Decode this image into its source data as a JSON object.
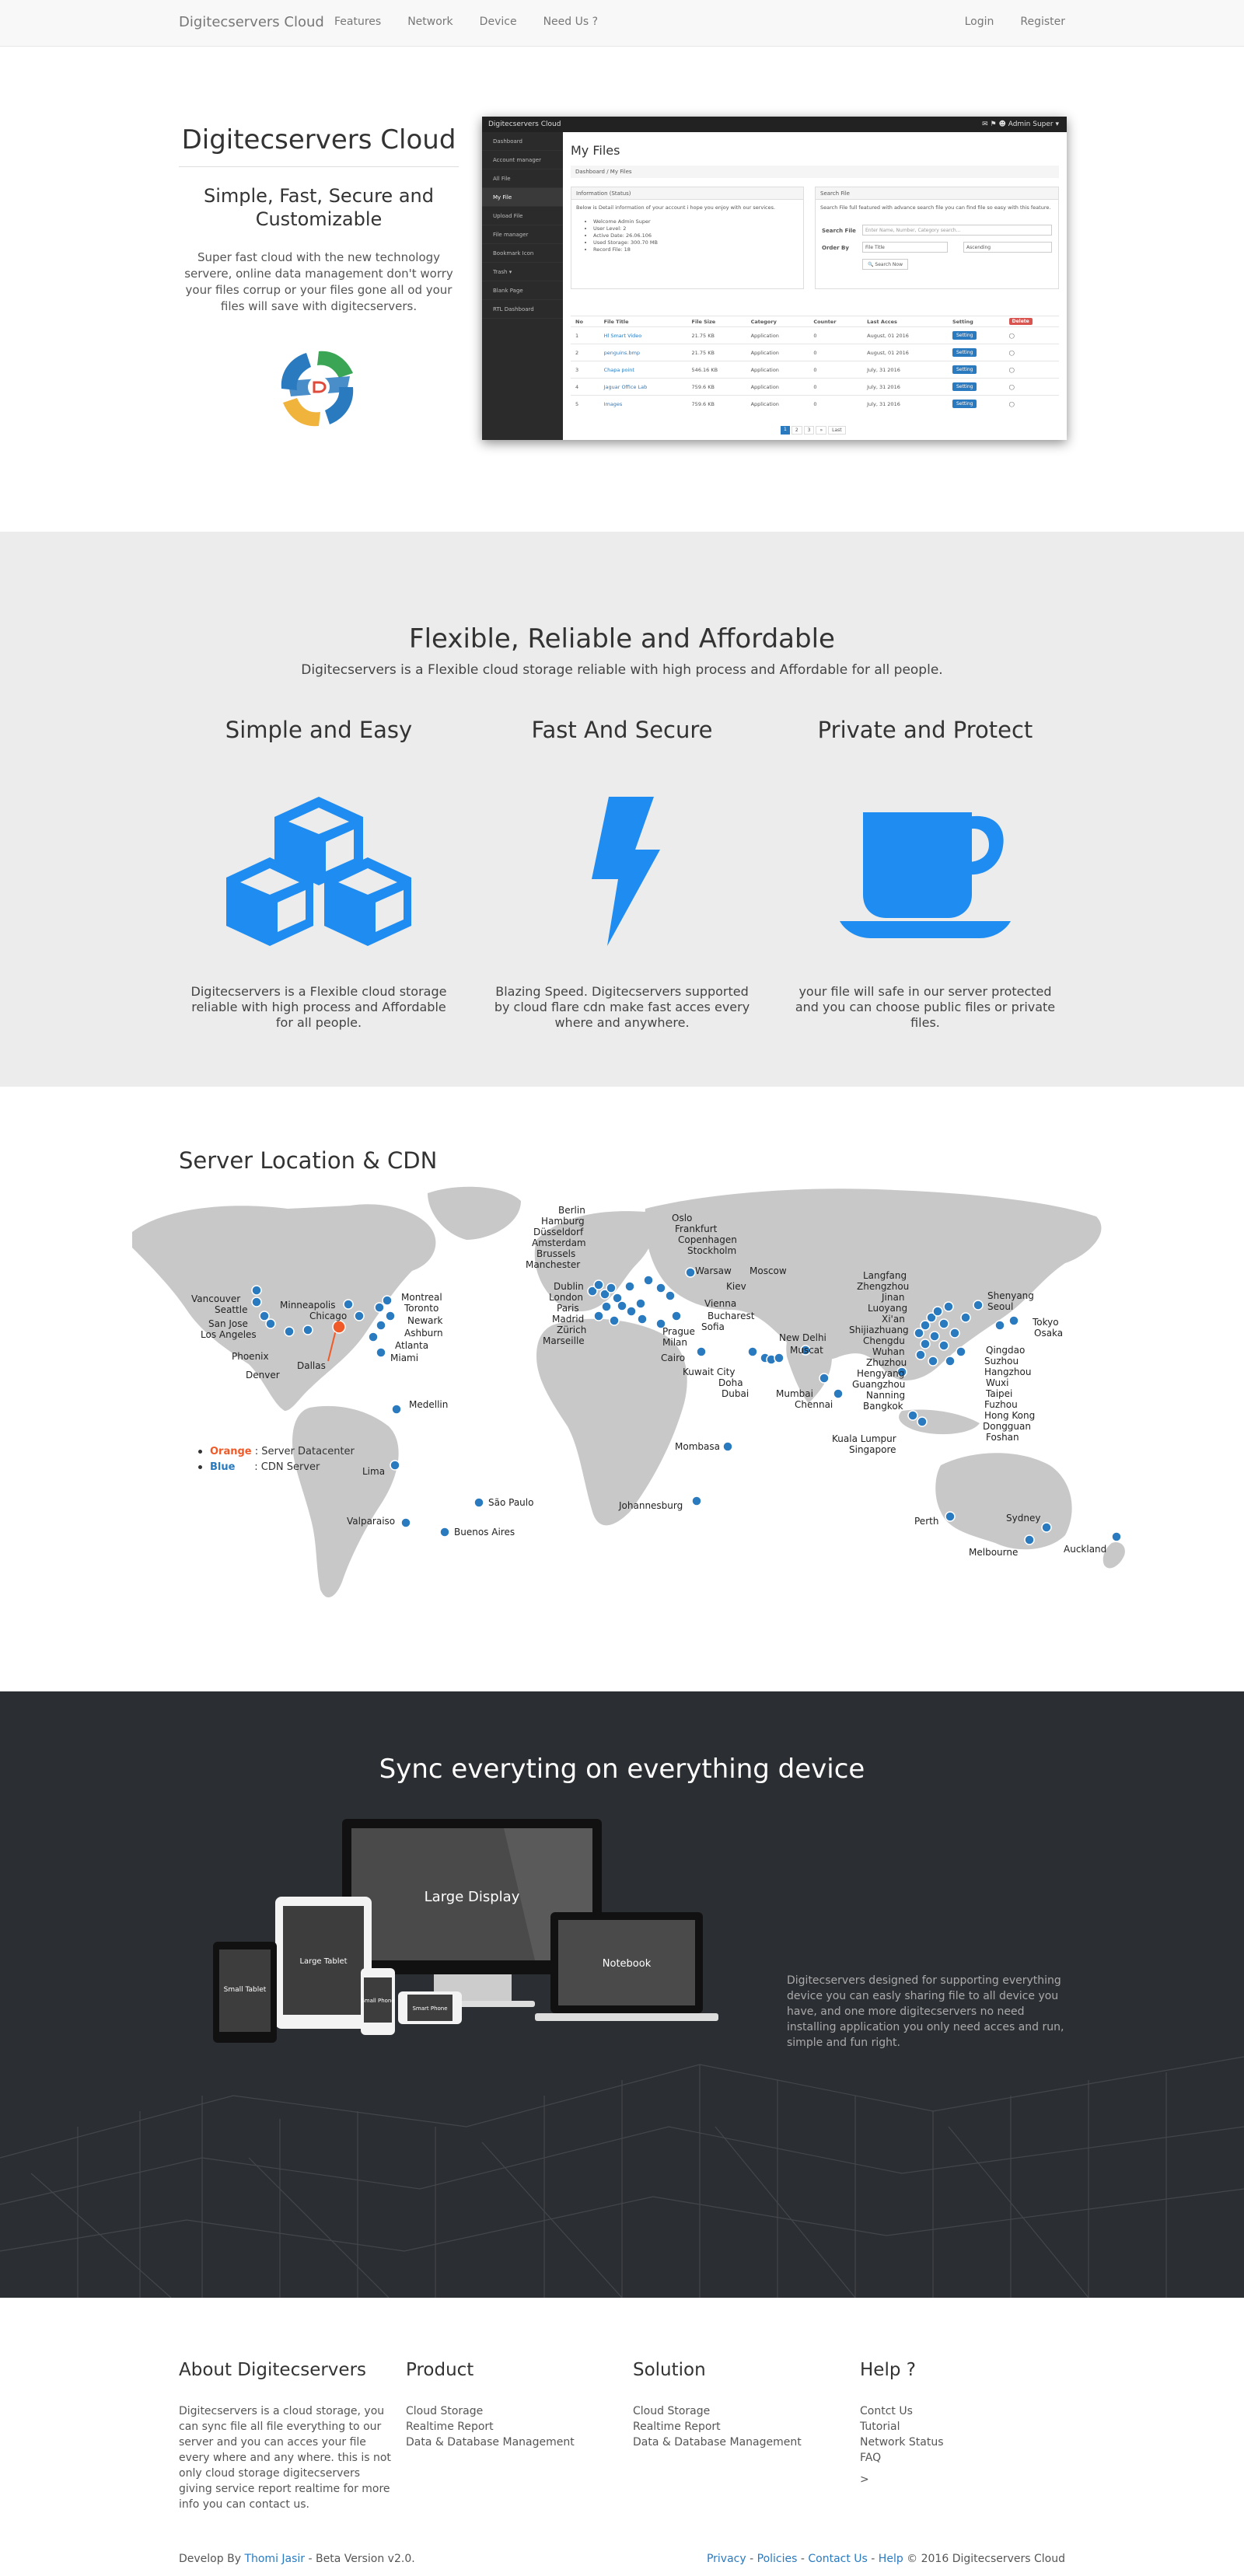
{
  "nav": {
    "brand": "Digitecservers Cloud",
    "links": [
      "Features",
      "Network",
      "Device",
      "Need Us ?"
    ],
    "login": "Login",
    "register": "Register"
  },
  "hero": {
    "title": "Digitecservers Cloud",
    "subtitle": "Simple, Fast, Secure and Customizable",
    "description": "Super fast cloud with the new technology servere, online data management don't worry your files corrup or your files gone all od your files will save with digitecservers."
  },
  "app_mock": {
    "topbar_title": "Digitecservers Cloud",
    "topbar_user": "Admin Super ▾",
    "sidebar": [
      "Dashboard",
      "Account manager",
      "All File",
      "My File",
      "Upload File",
      "File manager",
      "Bookmark Icon",
      "Trash ▾",
      "Blank Page",
      "RTL Dashboard"
    ],
    "active_index": 3,
    "heading": "My Files",
    "breadcrumb": "Dashboard  /  My Files",
    "info_panel_title": "Information (Status)",
    "info_panel_text": "Below is Detail information of your account i hope you enjoy with our services.",
    "info_items": [
      "Welcome Admin Super",
      "User Level: 2",
      "Active Date: 26.06.106",
      "Used Storage: 300.70 MB",
      "Record File: 18"
    ],
    "search_panel_title": "Search File",
    "search_panel_text": "Search File full featured with advance search file you can find file so easy with this feature.",
    "search_label": "Search File",
    "search_placeholder": "Enter Name, Number, Category search...",
    "order_label": "Order By",
    "order_value": "File Title",
    "sort_value": "Ascending",
    "search_button": "Search Now",
    "columns": [
      "No",
      "File Title",
      "File Size",
      "Category",
      "Counter",
      "Last Acces",
      "Setting"
    ],
    "delete_label": "Delete",
    "setting_label": "Setting",
    "rows": [
      {
        "no": "1",
        "title": "Hl Smart Video",
        "size": "21.75 KB",
        "category": "Application",
        "counter": "0",
        "last": "August, 01 2016"
      },
      {
        "no": "2",
        "title": "penguins.bmp",
        "size": "21.75 KB",
        "category": "Application",
        "counter": "0",
        "last": "August, 01 2016"
      },
      {
        "no": "3",
        "title": "Chapa point",
        "size": "546.16 KB",
        "category": "Application",
        "counter": "0",
        "last": "July, 31 2016"
      },
      {
        "no": "4",
        "title": "Jaguar Office Lab",
        "size": "759.6 KB",
        "category": "Application",
        "counter": "0",
        "last": "July, 31 2016"
      },
      {
        "no": "5",
        "title": "Images",
        "size": "759.6 KB",
        "category": "Application",
        "counter": "0",
        "last": "July, 31 2016"
      }
    ],
    "pagination": [
      "1",
      "2",
      "3",
      "»",
      "Last"
    ]
  },
  "features": {
    "title": "Flexible, Reliable and Affordable",
    "subtitle": "Digitecservers is a Flexible cloud storage reliable with high process and Affordable for all people.",
    "items": [
      {
        "title": "Simple and Easy",
        "icon": "cubes-icon",
        "text": "Digitecservers is a Flexible cloud storage reliable with high process and Affordable for all people."
      },
      {
        "title": "Fast And Secure",
        "icon": "lightning-icon",
        "text": "Blazing Speed. Digitecservers supported by cloud flare cdn make fast acces every where and anywhere."
      },
      {
        "title": "Private and Protect",
        "icon": "coffee-cup-icon",
        "text": "your file will safe in our server protected and you can choose public files or private files."
      }
    ],
    "accent_color": "#1e8cf0"
  },
  "map": {
    "title": "Server Location & CDN",
    "legend": [
      {
        "color_word": "Orange",
        "label": " : Server Datacenter",
        "color": "#f05a28"
      },
      {
        "color_word": "Blue",
        "label": "      : CDN Server",
        "color": "#2a7ac0"
      }
    ],
    "datacenter": "Dallas",
    "cities": {
      "europe_labels": [
        "Berlin",
        "Hamburg",
        "Düsseldorf",
        "Amsterdam",
        "Brussels",
        "Manchester",
        "Dublin",
        "London",
        "Paris",
        "Madrid",
        "Zürich",
        "Marseille",
        "Oslo",
        "Frankfurt",
        "Copenhagen",
        "Stockholm",
        "Warsaw",
        "Moscow",
        "Kiev",
        "Vienna",
        "Bucharest",
        "Sofia",
        "Prague",
        "Milan"
      ],
      "america_labels": [
        "Vancouver",
        "Seattle",
        "San Jose",
        "Los Angeles",
        "Phoenix",
        "Denver",
        "Minneapolis",
        "Chicago",
        "Montreal",
        "Toronto",
        "Newark",
        "Ashburn",
        "Atlanta",
        "Miami",
        "Medellin",
        "Lima",
        "Valparaiso",
        "São Paulo",
        "Buenos Aires"
      ],
      "asia_labels": [
        "Langfang",
        "Zhengzhou",
        "Jinan",
        "Luoyang",
        "Xi'an",
        "Shijiazhuang",
        "Chengdu",
        "Wuhan",
        "Zhuzhou",
        "Hengyang",
        "Guangzhou",
        "Nanning",
        "Bangkok",
        "Shenyang",
        "Seoul",
        "Tokyo",
        "Osaka",
        "Qingdao",
        "Suzhou",
        "Hangzhou",
        "Wuxi",
        "Taipei",
        "Fuzhou",
        "Hong Kong",
        "Dongguan",
        "Foshan",
        "New Delhi",
        "Muscat",
        "Kuwait City",
        "Doha",
        "Dubai",
        "Mumbai",
        "Chennai",
        "Kuala Lumpur",
        "Singapore",
        "Cairo",
        "Mombasa",
        "Johannesburg",
        "Perth",
        "Sydney",
        "Melbourne",
        "Auckland"
      ]
    }
  },
  "sync": {
    "title": "Sync everyting on everything device",
    "devices": [
      "Large Display",
      "Notebook",
      "Large Tablet",
      "Small Tablet",
      "Small Phone",
      "Smart Phone"
    ],
    "description": "Digitecservers designed for supporting everything device you can easly sharing file to all device you have, and one more digitecservers no need installing application you only need acces and run, simple and fun right."
  },
  "footer": {
    "about_title": "About Digitecservers",
    "about_text": "Digitecservers is a cloud storage, you can sync file all file everything to our server and you can acces your file every where and any where. this is not only cloud storage digitecservers giving service report realtime for more info you can contact us.",
    "product_title": "Product",
    "product_items": [
      "Cloud Storage",
      "Realtime Report",
      "Data & Database Management"
    ],
    "solution_title": "Solution",
    "solution_items": [
      "Cloud Storage",
      "Realtime Report",
      "Data & Database Management"
    ],
    "help_title": "Help ?",
    "help_items": [
      "Contct Us",
      "Tutorial",
      "Network Status",
      "FAQ",
      ">"
    ],
    "dev_prefix": "Develop By ",
    "dev_name": "Thomi Jasir",
    "dev_suffix": " - Beta Version v2.0.",
    "links": [
      "Privacy",
      "Policies",
      "Contact Us",
      "Help"
    ],
    "copyright": "© 2016 Digitecservers Cloud"
  }
}
